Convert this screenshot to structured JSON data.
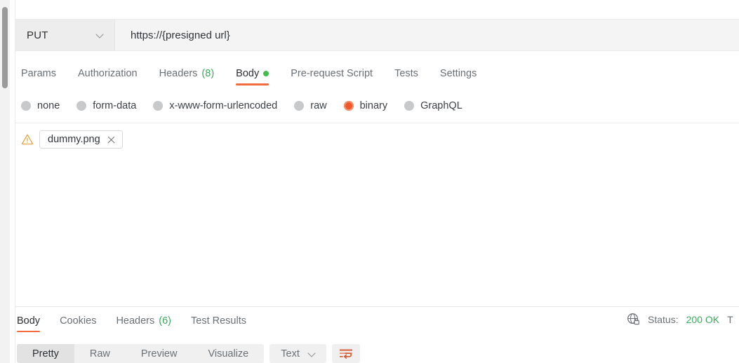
{
  "request": {
    "method": "PUT",
    "url": "https://{presigned url}",
    "method_dropdown_icon": "chevron-down-icon",
    "tabs": [
      {
        "label": "Params",
        "count": "",
        "active": false,
        "dot": false
      },
      {
        "label": "Authorization",
        "count": "",
        "active": false,
        "dot": false
      },
      {
        "label": "Headers",
        "count": "(8)",
        "active": false,
        "dot": false
      },
      {
        "label": "Body",
        "count": "",
        "active": true,
        "dot": true
      },
      {
        "label": "Pre-request Script",
        "count": "",
        "active": false,
        "dot": false
      },
      {
        "label": "Tests",
        "count": "",
        "active": false,
        "dot": false
      },
      {
        "label": "Settings",
        "count": "",
        "active": false,
        "dot": false
      }
    ],
    "body_types": [
      {
        "label": "none",
        "selected": false
      },
      {
        "label": "form-data",
        "selected": false
      },
      {
        "label": "x-www-form-urlencoded",
        "selected": false
      },
      {
        "label": "raw",
        "selected": false
      },
      {
        "label": "binary",
        "selected": true
      },
      {
        "label": "GraphQL",
        "selected": false
      }
    ],
    "binary_file": {
      "warning_icon": "warning-triangle-icon",
      "name": "dummy.png",
      "remove_icon": "close-icon"
    }
  },
  "response": {
    "tabs": [
      {
        "label": "Body",
        "count": "",
        "active": true
      },
      {
        "label": "Cookies",
        "count": "",
        "active": false
      },
      {
        "label": "Headers",
        "count": "(6)",
        "active": false
      },
      {
        "label": "Test Results",
        "count": "",
        "active": false
      }
    ],
    "status": {
      "security_icon": "globe-lock-icon",
      "label": "Status:",
      "code": "200 OK",
      "time_label_clipped": "T"
    },
    "viewer": {
      "modes": [
        {
          "label": "Pretty",
          "active": true
        },
        {
          "label": "Raw",
          "active": false
        },
        {
          "label": "Preview",
          "active": false
        },
        {
          "label": "Visualize",
          "active": false
        }
      ],
      "format_select": {
        "value": "Text",
        "icon": "chevron-down-icon"
      },
      "wrap_button_icon": "word-wrap-icon"
    }
  },
  "colors": {
    "accent": "#f26b3a",
    "success": "#3aab5c",
    "warning": "#e8a33d",
    "status_green": "#3aab5c"
  }
}
